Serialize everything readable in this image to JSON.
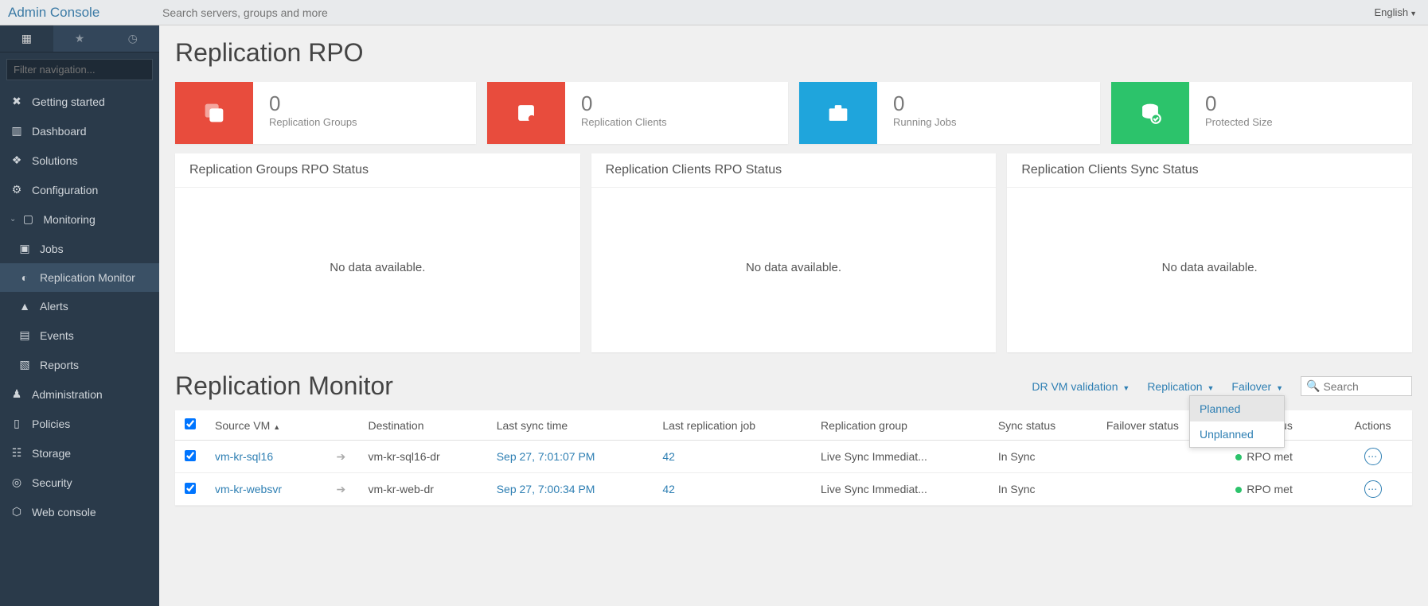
{
  "header": {
    "app_title": "Admin Console",
    "search_placeholder": "Search servers, groups and more",
    "language": "English"
  },
  "sidebar": {
    "filter_placeholder": "Filter navigation...",
    "items": [
      {
        "label": "Getting started"
      },
      {
        "label": "Dashboard"
      },
      {
        "label": "Solutions"
      },
      {
        "label": "Configuration"
      },
      {
        "label": "Monitoring"
      },
      {
        "label": "Jobs"
      },
      {
        "label": "Replication Monitor"
      },
      {
        "label": "Alerts"
      },
      {
        "label": "Events"
      },
      {
        "label": "Reports"
      },
      {
        "label": "Administration"
      },
      {
        "label": "Policies"
      },
      {
        "label": "Storage"
      },
      {
        "label": "Security"
      },
      {
        "label": "Web console"
      }
    ]
  },
  "page": {
    "title": "Replication RPO",
    "stats": [
      {
        "value": "0",
        "label": "Replication Groups"
      },
      {
        "value": "0",
        "label": "Replication Clients"
      },
      {
        "value": "0",
        "label": "Running Jobs"
      },
      {
        "value": "0",
        "label": "Protected Size"
      }
    ],
    "panels": [
      {
        "title": "Replication Groups RPO Status",
        "body": "No data available."
      },
      {
        "title": "Replication Clients RPO Status",
        "body": "No data available."
      },
      {
        "title": "Replication Clients Sync Status",
        "body": "No data available."
      }
    ]
  },
  "monitor": {
    "title": "Replication Monitor",
    "actions": {
      "dr": "DR VM validation",
      "replication": "Replication",
      "failover": "Failover",
      "search_placeholder": "Search"
    },
    "dropdown": {
      "planned": "Planned",
      "unplanned": "Unplanned"
    },
    "columns": {
      "source": "Source VM",
      "dest": "Destination",
      "last_sync": "Last sync time",
      "last_job": "Last replication job",
      "group": "Replication group",
      "sync": "Sync status",
      "failover": "Failover status",
      "rpo": "RPO status",
      "actions": "Actions"
    },
    "rows": [
      {
        "source": "vm-kr-sql16",
        "dest": "vm-kr-sql16-dr",
        "last_sync": "Sep 27, 7:01:07 PM",
        "last_job": "42",
        "group": "Live Sync Immediat...",
        "sync": "In Sync",
        "failover": "",
        "rpo": "RPO met"
      },
      {
        "source": "vm-kr-websvr",
        "dest": "vm-kr-web-dr",
        "last_sync": "Sep 27, 7:00:34 PM",
        "last_job": "42",
        "group": "Live Sync Immediat...",
        "sync": "In Sync",
        "failover": "",
        "rpo": "RPO met"
      }
    ]
  }
}
